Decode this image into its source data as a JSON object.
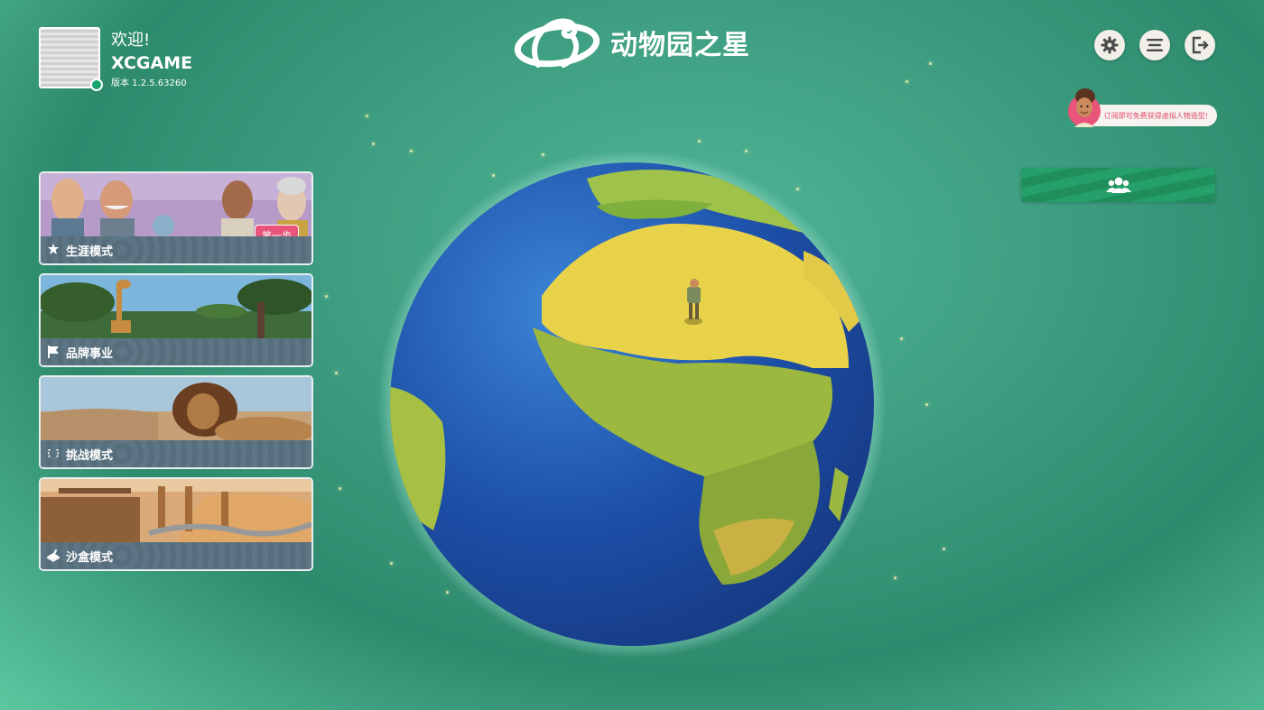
{
  "profile": {
    "welcome": "欢迎!",
    "username": "XCGAME",
    "version": "版本 1.2.5.63260",
    "status_color": "#17a36e"
  },
  "header": {
    "title": "动物园之星"
  },
  "top_buttons": [
    {
      "name": "settings",
      "icon": "gear-icon"
    },
    {
      "name": "menu",
      "icon": "hamburger-icon"
    },
    {
      "name": "exit",
      "icon": "exit-icon"
    }
  ],
  "promo": {
    "text": "订阅即可免费获得虚拟人物造型!"
  },
  "friends_button": {
    "icon": "users-icon"
  },
  "modes": [
    {
      "label": "生涯模式",
      "icon": "stars-icon",
      "badge": "第一步"
    },
    {
      "label": "品牌事业",
      "icon": "flag-icon"
    },
    {
      "label": "挑战模式",
      "icon": "laurel-icon"
    },
    {
      "label": "沙盒模式",
      "icon": "sandbox-icon"
    }
  ],
  "colors": {
    "accent_green": "#1f8e5b",
    "badge_pink": "#e8547a",
    "card_bar": "#5d7584"
  }
}
